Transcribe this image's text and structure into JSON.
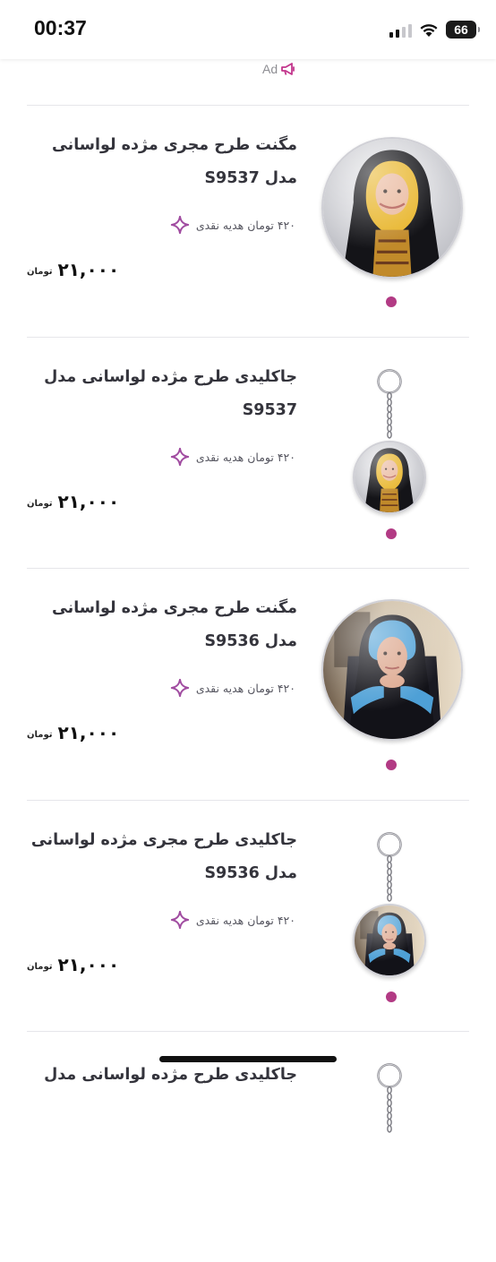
{
  "status_bar": {
    "time": "00:37",
    "battery": "66"
  },
  "ad": {
    "label": "Ad",
    "icon": "megaphone-icon"
  },
  "accent_color": "#b23a84",
  "products": [
    {
      "title": "مگنت طرح مجری مژده لواسانی مدل S9537",
      "gift": "۴۲۰ تومان هدیه نقدی",
      "price": "۲۱,۰۰۰",
      "currency": "تومان",
      "type": "magnet",
      "image": "portrait-yellow-scarf"
    },
    {
      "title": "جاکلیدی طرح مژده لواسانی مدل S9537",
      "gift": "۴۲۰ تومان هدیه نقدی",
      "price": "۲۱,۰۰۰",
      "currency": "تومان",
      "type": "keychain",
      "image": "portrait-yellow-scarf"
    },
    {
      "title": "مگنت طرح مجری مژده لواسانی مدل S9536",
      "gift": "۴۲۰ تومان هدیه نقدی",
      "price": "۲۱,۰۰۰",
      "currency": "تومان",
      "type": "magnet",
      "image": "portrait-blue-scarf"
    },
    {
      "title": "جاکلیدی طرح مجری مژده لواسانی مدل S9536",
      "gift": "۴۲۰ تومان هدیه نقدی",
      "price": "۲۱,۰۰۰",
      "currency": "تومان",
      "type": "keychain",
      "image": "portrait-blue-scarf"
    },
    {
      "title": "جاکلیدی طرح مژده لواسانی مدل",
      "type": "keychain"
    }
  ]
}
